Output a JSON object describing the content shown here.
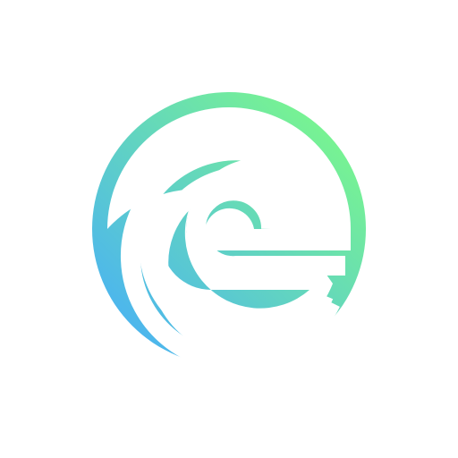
{
  "logo": {
    "icon": "spiral-e-logo-icon",
    "colors": {
      "gradient_start": "#44AAFF",
      "gradient_end": "#80FF80",
      "background": "#FFFFFF"
    }
  }
}
